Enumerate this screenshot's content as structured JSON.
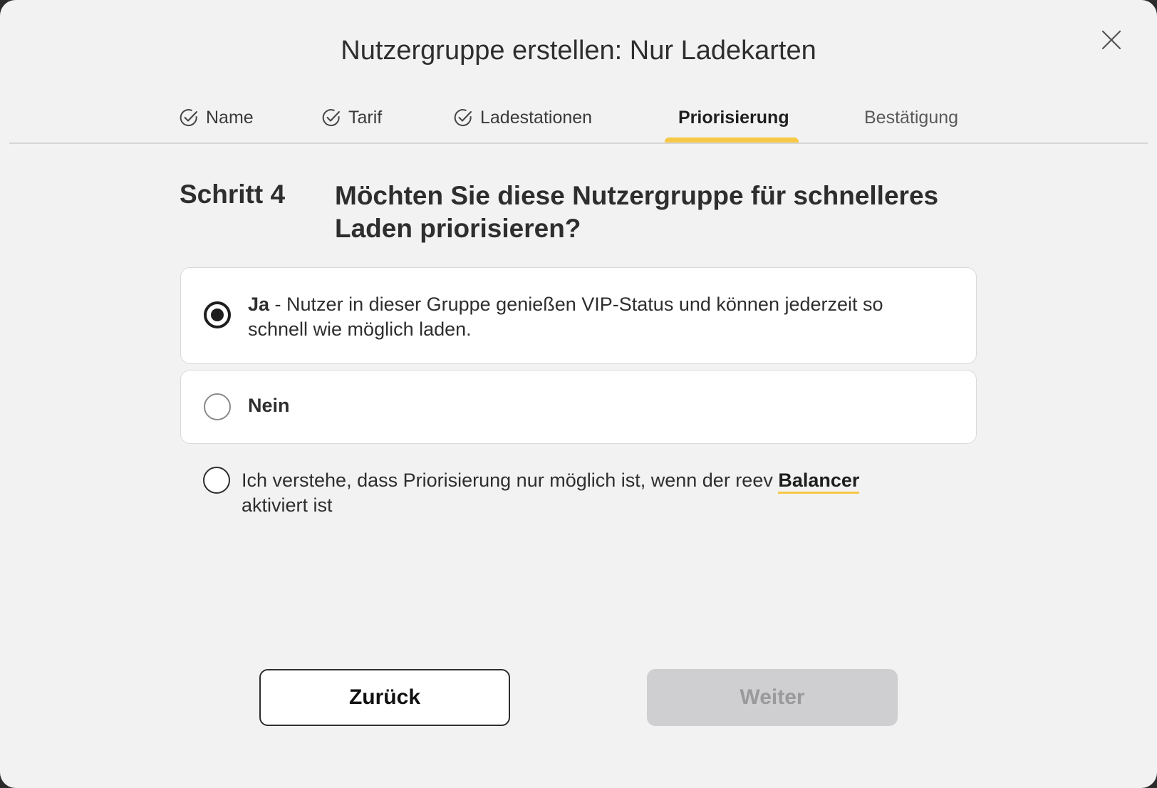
{
  "dialog": {
    "title": "Nutzergruppe erstellen: Nur Ladekarten",
    "close_icon": "close-icon"
  },
  "steps": [
    {
      "label": "Name",
      "state": "done",
      "icon": "check-circle-icon"
    },
    {
      "label": "Tarif",
      "state": "done",
      "icon": "check-circle-icon"
    },
    {
      "label": "Ladestationen",
      "state": "done",
      "icon": "check-circle-icon"
    },
    {
      "label": "Priorisierung",
      "state": "active"
    },
    {
      "label": "Bestätigung",
      "state": "pending"
    }
  ],
  "content": {
    "step_label": "Schritt 4",
    "question": "Möchten Sie diese Nutzergruppe für schnelleres Laden priorisieren?",
    "options": [
      {
        "label_bold": "Ja",
        "label_rest": " - Nutzer in dieser Gruppe genießen VIP-Status und können jederzeit so schnell wie möglich laden.",
        "selected": true
      },
      {
        "label_bold": "Nein",
        "label_rest": "",
        "selected": false
      }
    ],
    "consent": {
      "text_before": "Ich verstehe, dass Priorisierung nur möglich ist, wenn der reev ",
      "link": "Balancer",
      "text_after": " aktiviert ist",
      "checked": false
    }
  },
  "footer": {
    "back_label": "Zurück",
    "next_label": "Weiter",
    "next_enabled": false
  },
  "colors": {
    "accent": "#f7c845",
    "background": "#f2f2f2",
    "disabled_button": "#cfcfd1"
  }
}
